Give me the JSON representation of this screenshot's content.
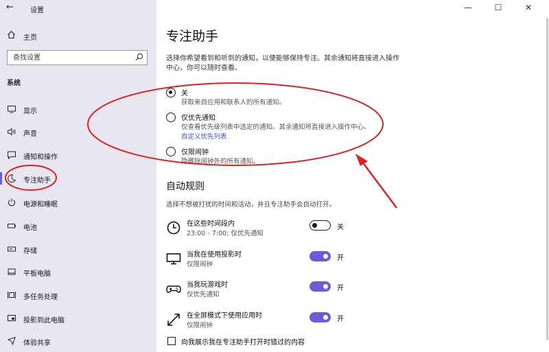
{
  "window": {
    "title": "设置",
    "minimize": "—",
    "maximize": "☐",
    "close": "✕"
  },
  "sidebar": {
    "home_label": "主页",
    "search_placeholder": "查找设置",
    "section_title": "系统",
    "items": [
      {
        "label": "显示",
        "icon": "display-icon"
      },
      {
        "label": "声音",
        "icon": "sound-icon"
      },
      {
        "label": "通知和操作",
        "icon": "notification-icon"
      },
      {
        "label": "专注助手",
        "icon": "moon-icon",
        "active": true
      },
      {
        "label": "电源和睡眠",
        "icon": "power-icon"
      },
      {
        "label": "电池",
        "icon": "battery-icon"
      },
      {
        "label": "存储",
        "icon": "storage-icon"
      },
      {
        "label": "平板电脑",
        "icon": "tablet-icon"
      },
      {
        "label": "多任务处理",
        "icon": "multitask-icon"
      },
      {
        "label": "投影到此电脑",
        "icon": "project-icon"
      },
      {
        "label": "体验共享",
        "icon": "share-icon"
      }
    ]
  },
  "main": {
    "title": "专注助手",
    "description": "选择你希望看到和听到的通知，以便能够保持专注。其余通知将直接进入操作中心，你可以随时查看。",
    "options": [
      {
        "label": "关",
        "sub": "获取来自应用和联系人的所有通知。",
        "checked": true
      },
      {
        "label": "仅优先通知",
        "sub": "仅查看优先级列表中选定的通知。其余通知将直接进入操作中心。",
        "link": "自定义优先列表",
        "checked": false
      },
      {
        "label": "仅限闹钟",
        "sub": "隐藏除闹钟外的所有通知。",
        "checked": false
      }
    ],
    "auto_rules_title": "自动规则",
    "auto_rules_desc": "选择不想被打扰的时间和活动，并且专注助手会自动打开。",
    "rules": [
      {
        "name": "在这些时间段内",
        "sub": "23:00 - 7:00; 仅优先通知",
        "state": "关",
        "on": false,
        "icon": "clock-icon"
      },
      {
        "name": "当我在使用投影时",
        "sub": "仅限闹钟",
        "state": "开",
        "on": true,
        "icon": "monitor-icon"
      },
      {
        "name": "当我玩游戏时",
        "sub": "仅优先通知",
        "state": "开",
        "on": true,
        "icon": "gamepad-icon"
      },
      {
        "name": "在全屏模式下使用应用时",
        "sub": "仅限闹钟",
        "state": "开",
        "on": true,
        "icon": "fullscreen-icon"
      }
    ],
    "checkbox_label": "向我展示我在专注助手打开时错过的内容"
  },
  "colors": {
    "accent": "#6b5bd6",
    "sidebar_bg": "#e8e6f0",
    "annotation": "#e02020"
  }
}
